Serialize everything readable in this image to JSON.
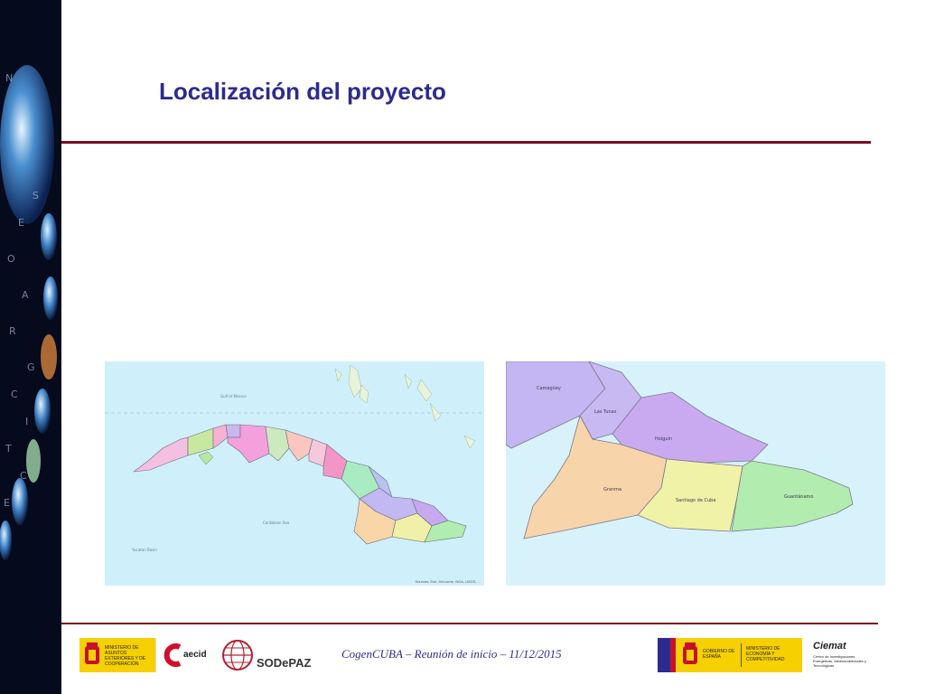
{
  "slide": {
    "title": "Localización del proyecto"
  },
  "maps": {
    "left": {
      "credit": "Sources: Esri, DeLorme, NGA, USGS, ..."
    },
    "right": {
      "provinces": [
        "Camagüey",
        "Las Tunas",
        "Holguín",
        "Granma",
        "Santiago de Cuba",
        "Guantánamo"
      ]
    }
  },
  "footer": {
    "text": "CogenCUBA – Reunión de inicio – 11/12/2015",
    "logos": {
      "maec": "MINISTERIO DE ASUNTOS EXTERIORES Y DE COOPERACIÓN",
      "aecid": "aecid",
      "sodepaz": "SODePAZ",
      "gobierno": "GOBIERNO DE ESPAÑA",
      "mineco": "MINISTERIO DE ECONOMÍA Y COMPETITIVIDAD",
      "ciemat": "Ciemat",
      "ciemat_sub": "Centro de Investigaciones Energéticas, Medioambientales y Tecnológicas"
    }
  },
  "colors": {
    "title": "#2b2b8f",
    "rule": "#7a0f1e",
    "sidebar": "#050a1c"
  }
}
